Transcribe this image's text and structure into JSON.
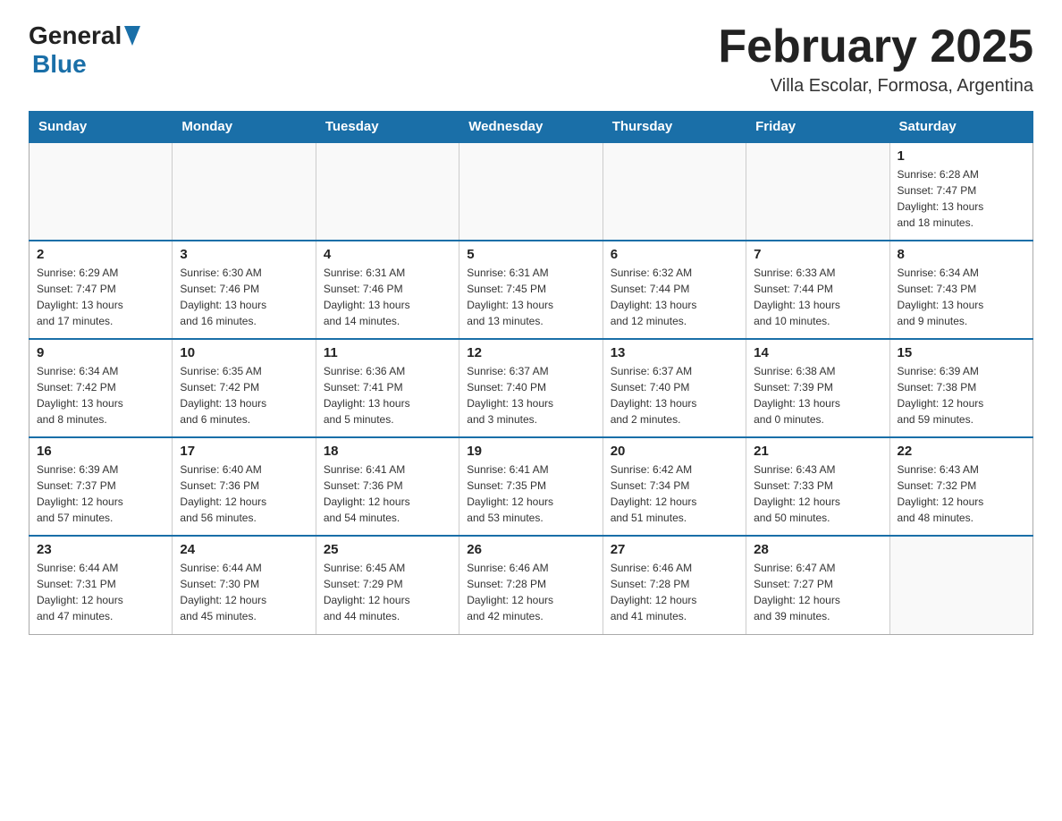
{
  "header": {
    "logo_general": "General",
    "logo_blue": "Blue",
    "month_title": "February 2025",
    "location": "Villa Escolar, Formosa, Argentina"
  },
  "weekdays": [
    "Sunday",
    "Monday",
    "Tuesday",
    "Wednesday",
    "Thursday",
    "Friday",
    "Saturday"
  ],
  "weeks": [
    [
      {
        "day": "",
        "info": ""
      },
      {
        "day": "",
        "info": ""
      },
      {
        "day": "",
        "info": ""
      },
      {
        "day": "",
        "info": ""
      },
      {
        "day": "",
        "info": ""
      },
      {
        "day": "",
        "info": ""
      },
      {
        "day": "1",
        "info": "Sunrise: 6:28 AM\nSunset: 7:47 PM\nDaylight: 13 hours\nand 18 minutes."
      }
    ],
    [
      {
        "day": "2",
        "info": "Sunrise: 6:29 AM\nSunset: 7:47 PM\nDaylight: 13 hours\nand 17 minutes."
      },
      {
        "day": "3",
        "info": "Sunrise: 6:30 AM\nSunset: 7:46 PM\nDaylight: 13 hours\nand 16 minutes."
      },
      {
        "day": "4",
        "info": "Sunrise: 6:31 AM\nSunset: 7:46 PM\nDaylight: 13 hours\nand 14 minutes."
      },
      {
        "day": "5",
        "info": "Sunrise: 6:31 AM\nSunset: 7:45 PM\nDaylight: 13 hours\nand 13 minutes."
      },
      {
        "day": "6",
        "info": "Sunrise: 6:32 AM\nSunset: 7:44 PM\nDaylight: 13 hours\nand 12 minutes."
      },
      {
        "day": "7",
        "info": "Sunrise: 6:33 AM\nSunset: 7:44 PM\nDaylight: 13 hours\nand 10 minutes."
      },
      {
        "day": "8",
        "info": "Sunrise: 6:34 AM\nSunset: 7:43 PM\nDaylight: 13 hours\nand 9 minutes."
      }
    ],
    [
      {
        "day": "9",
        "info": "Sunrise: 6:34 AM\nSunset: 7:42 PM\nDaylight: 13 hours\nand 8 minutes."
      },
      {
        "day": "10",
        "info": "Sunrise: 6:35 AM\nSunset: 7:42 PM\nDaylight: 13 hours\nand 6 minutes."
      },
      {
        "day": "11",
        "info": "Sunrise: 6:36 AM\nSunset: 7:41 PM\nDaylight: 13 hours\nand 5 minutes."
      },
      {
        "day": "12",
        "info": "Sunrise: 6:37 AM\nSunset: 7:40 PM\nDaylight: 13 hours\nand 3 minutes."
      },
      {
        "day": "13",
        "info": "Sunrise: 6:37 AM\nSunset: 7:40 PM\nDaylight: 13 hours\nand 2 minutes."
      },
      {
        "day": "14",
        "info": "Sunrise: 6:38 AM\nSunset: 7:39 PM\nDaylight: 13 hours\nand 0 minutes."
      },
      {
        "day": "15",
        "info": "Sunrise: 6:39 AM\nSunset: 7:38 PM\nDaylight: 12 hours\nand 59 minutes."
      }
    ],
    [
      {
        "day": "16",
        "info": "Sunrise: 6:39 AM\nSunset: 7:37 PM\nDaylight: 12 hours\nand 57 minutes."
      },
      {
        "day": "17",
        "info": "Sunrise: 6:40 AM\nSunset: 7:36 PM\nDaylight: 12 hours\nand 56 minutes."
      },
      {
        "day": "18",
        "info": "Sunrise: 6:41 AM\nSunset: 7:36 PM\nDaylight: 12 hours\nand 54 minutes."
      },
      {
        "day": "19",
        "info": "Sunrise: 6:41 AM\nSunset: 7:35 PM\nDaylight: 12 hours\nand 53 minutes."
      },
      {
        "day": "20",
        "info": "Sunrise: 6:42 AM\nSunset: 7:34 PM\nDaylight: 12 hours\nand 51 minutes."
      },
      {
        "day": "21",
        "info": "Sunrise: 6:43 AM\nSunset: 7:33 PM\nDaylight: 12 hours\nand 50 minutes."
      },
      {
        "day": "22",
        "info": "Sunrise: 6:43 AM\nSunset: 7:32 PM\nDaylight: 12 hours\nand 48 minutes."
      }
    ],
    [
      {
        "day": "23",
        "info": "Sunrise: 6:44 AM\nSunset: 7:31 PM\nDaylight: 12 hours\nand 47 minutes."
      },
      {
        "day": "24",
        "info": "Sunrise: 6:44 AM\nSunset: 7:30 PM\nDaylight: 12 hours\nand 45 minutes."
      },
      {
        "day": "25",
        "info": "Sunrise: 6:45 AM\nSunset: 7:29 PM\nDaylight: 12 hours\nand 44 minutes."
      },
      {
        "day": "26",
        "info": "Sunrise: 6:46 AM\nSunset: 7:28 PM\nDaylight: 12 hours\nand 42 minutes."
      },
      {
        "day": "27",
        "info": "Sunrise: 6:46 AM\nSunset: 7:28 PM\nDaylight: 12 hours\nand 41 minutes."
      },
      {
        "day": "28",
        "info": "Sunrise: 6:47 AM\nSunset: 7:27 PM\nDaylight: 12 hours\nand 39 minutes."
      },
      {
        "day": "",
        "info": ""
      }
    ]
  ]
}
